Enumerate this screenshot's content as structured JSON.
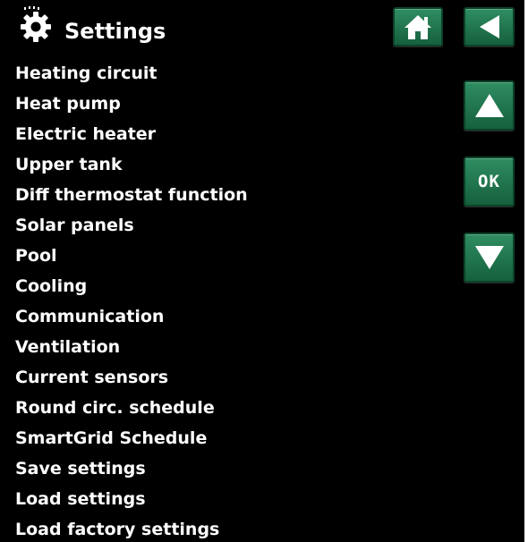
{
  "header": {
    "title": "Settings",
    "icon": "gear-icon"
  },
  "menu": {
    "items": [
      {
        "label": "Heating circuit"
      },
      {
        "label": "Heat pump"
      },
      {
        "label": "Electric heater"
      },
      {
        "label": "Upper tank"
      },
      {
        "label": "Diff thermostat function"
      },
      {
        "label": "Solar panels"
      },
      {
        "label": "Pool"
      },
      {
        "label": "Cooling"
      },
      {
        "label": "Communication"
      },
      {
        "label": "Ventilation"
      },
      {
        "label": "Current sensors"
      },
      {
        "label": "Round circ. schedule"
      },
      {
        "label": "SmartGrid Schedule"
      },
      {
        "label": "Save settings"
      },
      {
        "label": "Load settings"
      },
      {
        "label": "Load factory settings"
      }
    ]
  },
  "nav": {
    "home_icon": "home-icon",
    "back_icon": "back-arrow-icon",
    "up_icon": "up-arrow-icon",
    "ok_label": "OK",
    "down_icon": "down-arrow-icon"
  },
  "colors": {
    "background": "#000000",
    "text": "#ffffff",
    "button": "#237a4f",
    "button_border": "#0c4229"
  }
}
